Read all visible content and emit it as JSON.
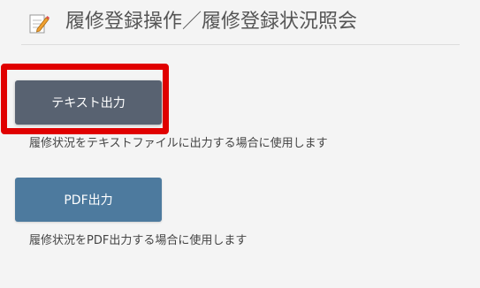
{
  "header": {
    "title": "履修登録操作／履修登録状況照会",
    "icon": "note-edit-icon"
  },
  "actions": [
    {
      "label": "テキスト出力",
      "description": "履修状況をテキストファイルに出力する場合に使用します",
      "color": "#586271",
      "highlighted": true,
      "highlight_color": "#e00000"
    },
    {
      "label": "PDF出力",
      "description": "履修状況をPDF出力する場合に使用します",
      "color": "#4d7a9e",
      "highlighted": false
    }
  ]
}
